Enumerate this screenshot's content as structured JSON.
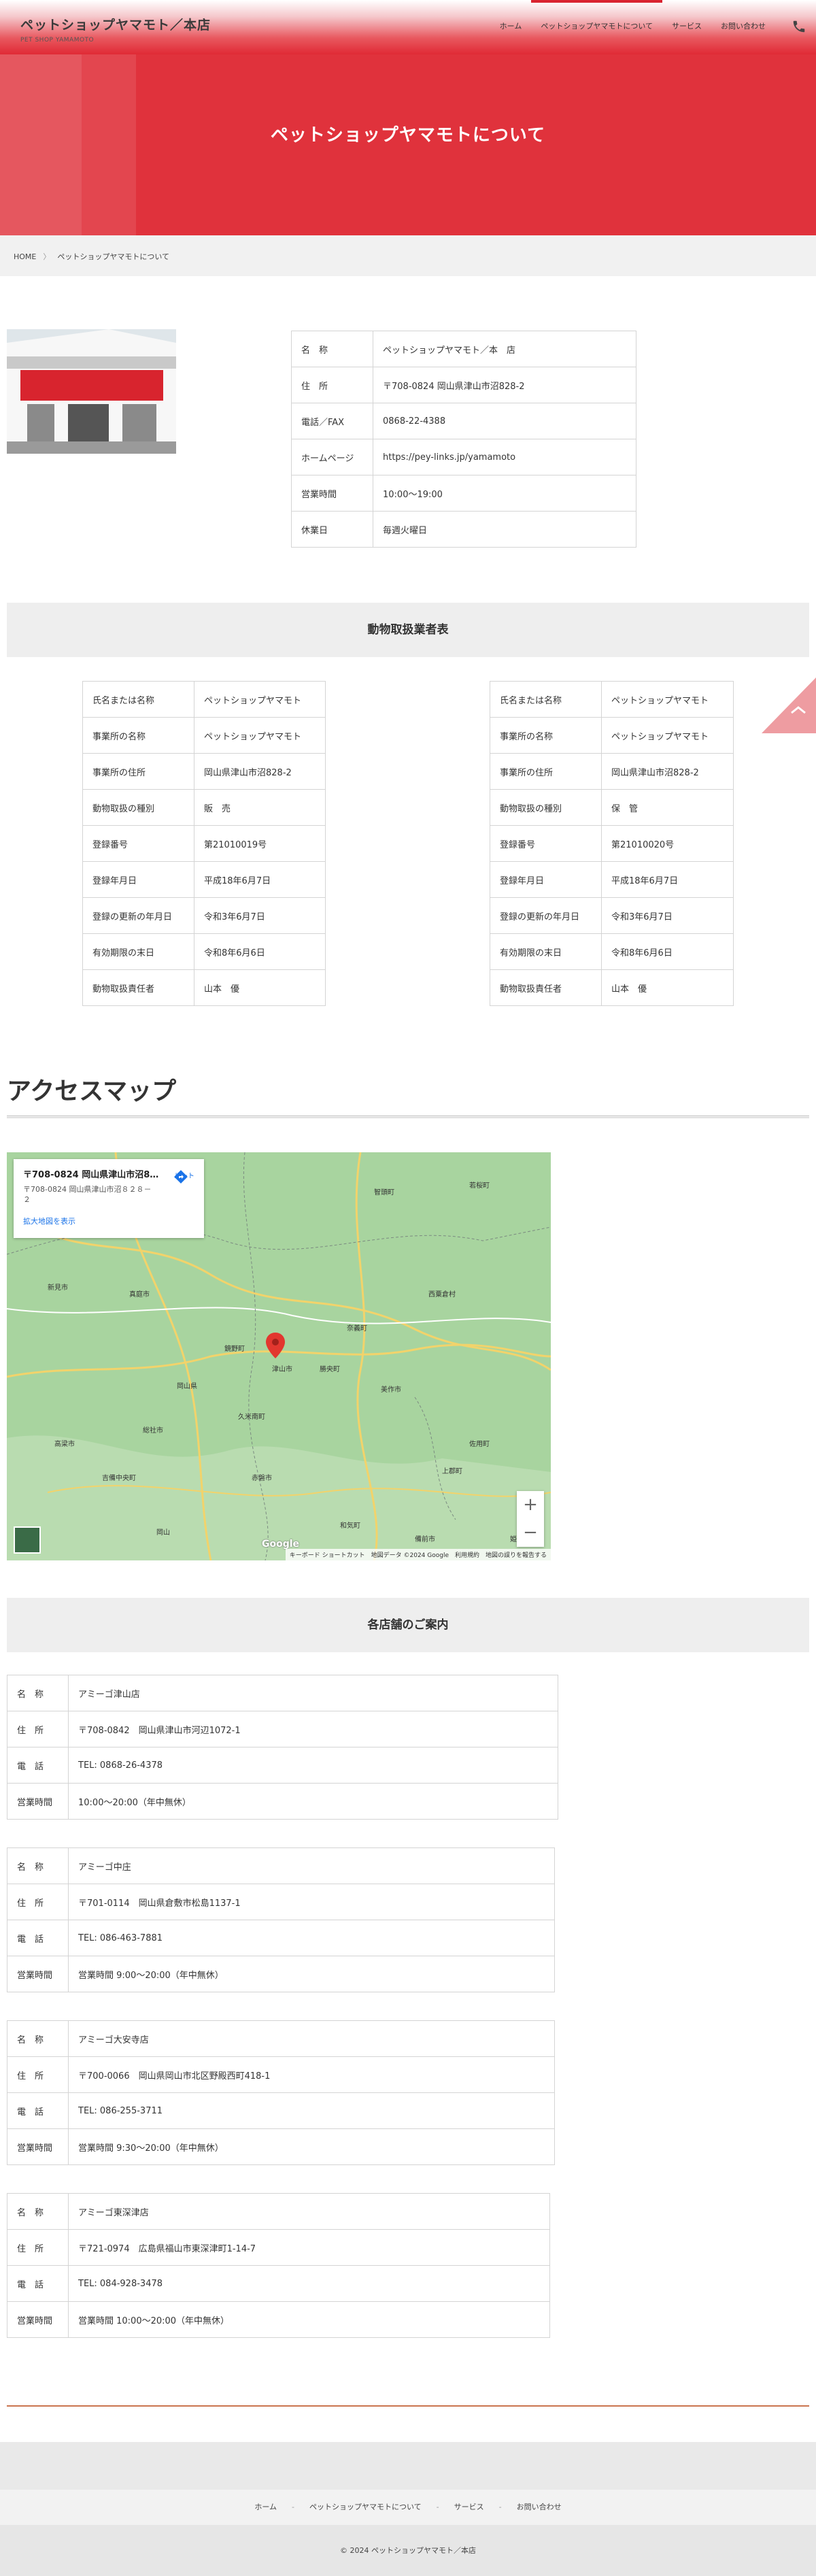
{
  "header": {
    "title": "ペットショップヤマモト／本店",
    "subtitle": "PET SHOP YAMAMOTO",
    "nav": [
      "ホーム",
      "ペットショップヤマモトについて",
      "サービス",
      "お問い合わせ"
    ]
  },
  "hero": {
    "title": "ペットショップヤマモトについて"
  },
  "breadcrumb": {
    "home": "HOME",
    "current": "ペットショップヤマモトについて"
  },
  "info": [
    {
      "k": "名　称",
      "v": "ペットショップヤマモト／本　店"
    },
    {
      "k": "住　所",
      "v": "〒708-0824  岡山県津山市沼828-2"
    },
    {
      "k": "電話／FAX",
      "v": "0868-22-4388"
    },
    {
      "k": "ホームページ",
      "v": "https://pey-links.jp/yamamoto"
    },
    {
      "k": "営業時間",
      "v": "10:00〜19:00"
    },
    {
      "k": "休業日",
      "v": "毎週火曜日"
    }
  ],
  "animal_section": "動物取扱業者表",
  "animal_left": [
    {
      "k": "氏名または名称",
      "v": "ペットショップヤマモト"
    },
    {
      "k": "事業所の名称",
      "v": "ペットショップヤマモト"
    },
    {
      "k": "事業所の住所",
      "v": "岡山県津山市沼828-2"
    },
    {
      "k": "動物取扱の種別",
      "v": "販　売"
    },
    {
      "k": "登録番号",
      "v": "第21010019号"
    },
    {
      "k": "登録年月日",
      "v": "平成18年6月7日"
    },
    {
      "k": "登録の更新の年月日",
      "v": "令和3年6月7日"
    },
    {
      "k": "有効期限の末日",
      "v": "令和8年6月6日"
    },
    {
      "k": "動物取扱責任者",
      "v": "山本　優"
    }
  ],
  "animal_right": [
    {
      "k": "氏名または名称",
      "v": "ペットショップヤマモト"
    },
    {
      "k": "事業所の名称",
      "v": "ペットショップヤマモト"
    },
    {
      "k": "事業所の住所",
      "v": "岡山県津山市沼828-2"
    },
    {
      "k": "動物取扱の種別",
      "v": "保　管"
    },
    {
      "k": "登録番号",
      "v": "第21010020号"
    },
    {
      "k": "登録年月日",
      "v": "平成18年6月7日"
    },
    {
      "k": "登録の更新の年月日",
      "v": "令和3年6月7日"
    },
    {
      "k": "有効期限の末日",
      "v": "令和8年6月6日"
    },
    {
      "k": "動物取扱責任者",
      "v": "山本　優"
    }
  ],
  "access": {
    "title": "アクセスマップ",
    "card_title": "〒708-0824 岡山県津山市沼8…",
    "card_addr": "〒708-0824 岡山県津山市沼８２８－２",
    "route": "ルート",
    "larger": "拡大地図を表示",
    "footer": "キーボード ショートカット　地図データ ©2024 Google　利用規約　地図の誤りを報告する",
    "labels": [
      "岡山県",
      "津山市",
      "真庭市",
      "美作市",
      "鏡野町",
      "勝央町",
      "奈義町",
      "久米南町",
      "吉備中央町",
      "赤磐市",
      "和気町",
      "備前市",
      "新見市",
      "西粟倉村",
      "上郡町",
      "佐用町",
      "智頭町",
      "若桜町",
      "高梁市",
      "総社市",
      "岡山",
      "姫路"
    ]
  },
  "stores_section": "各店舗のご案内",
  "stores": [
    [
      {
        "k": "名　称",
        "v": "アミーゴ津山店"
      },
      {
        "k": "住　所",
        "v": "〒708-0842　岡山県津山市河辺1072-1"
      },
      {
        "k": "電　話",
        "v": "TEL: 0868-26-4378"
      },
      {
        "k": "営業時間",
        "v": "10:00〜20:00（年中無休）"
      }
    ],
    [
      {
        "k": "名　称",
        "v": "アミーゴ中庄"
      },
      {
        "k": "住　所",
        "v": "〒701-0114　岡山県倉敷市松島1137-1"
      },
      {
        "k": "電　話",
        "v": "TEL: 086-463-7881"
      },
      {
        "k": "営業時間",
        "v": "営業時間 9:00〜20:00（年中無休）"
      }
    ],
    [
      {
        "k": "名　称",
        "v": "アミーゴ大安寺店"
      },
      {
        "k": "住　所",
        "v": "〒700-0066　岡山県岡山市北区野殿西町418-1"
      },
      {
        "k": "電　話",
        "v": "TEL: 086-255-3711"
      },
      {
        "k": "営業時間",
        "v": "営業時間 9:30〜20:00（年中無休）"
      }
    ],
    [
      {
        "k": "名　称",
        "v": "アミーゴ東深津店"
      },
      {
        "k": "住　所",
        "v": "〒721-0974　広島県福山市東深津町1-14-7"
      },
      {
        "k": "電　話",
        "v": "TEL: 084-928-3478"
      },
      {
        "k": "営業時間",
        "v": "営業時間 10:00〜20:00（年中無休）"
      }
    ]
  ],
  "footer": {
    "links": [
      "ホーム",
      "ペットショップヤマモトについて",
      "サービス",
      "お問い合わせ"
    ],
    "copyright": "© 2024 ペットショップヤマモト／本店"
  }
}
